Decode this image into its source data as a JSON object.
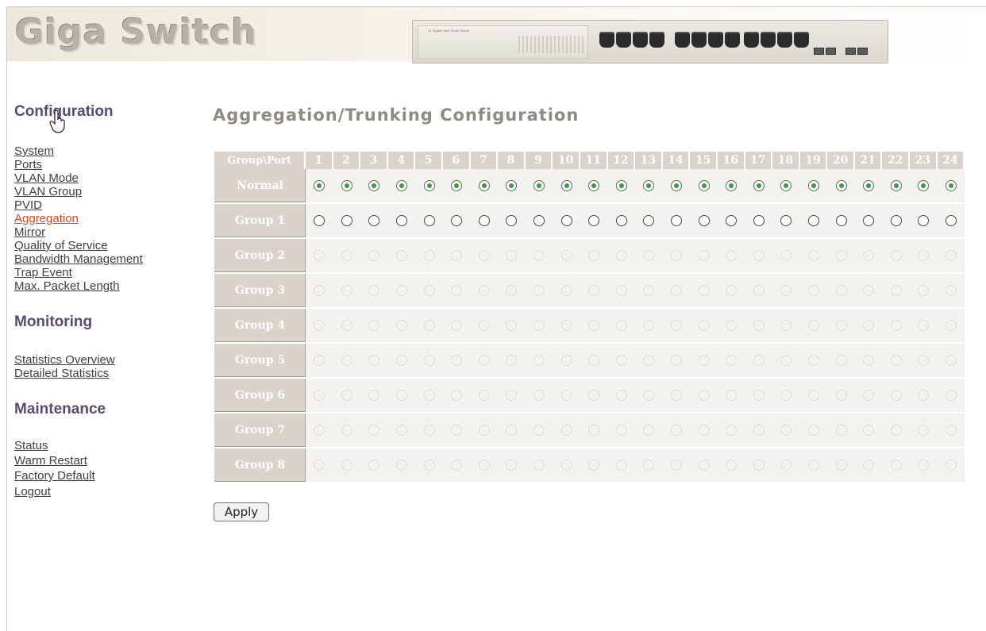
{
  "header": {
    "brand": "Giga Switch",
    "device_image": {
      "plate_text": "24 Gigabit Web Smart Switch"
    }
  },
  "sidebar": {
    "sections": [
      {
        "title": "Configuration",
        "links": [
          "System",
          "Ports",
          "VLAN Mode",
          "VLAN Group",
          "PVID",
          "Aggregation",
          "Mirror",
          "Quality of Service",
          "Bandwidth Management",
          "Trap Event",
          "Max. Packet Length"
        ]
      },
      {
        "title": "Monitoring",
        "links": [
          "Statistics Overview",
          "Detailed Statistics"
        ]
      },
      {
        "title": "Maintenance",
        "links": [
          "Status",
          "Warm Restart",
          "Factory Default",
          "Logout"
        ]
      }
    ],
    "active_link": "Aggregation"
  },
  "main": {
    "title": "Aggregation/Trunking Configuration",
    "table": {
      "corner_label": "Group\\Port",
      "ports": [
        "1",
        "2",
        "3",
        "4",
        "5",
        "6",
        "7",
        "8",
        "9",
        "10",
        "11",
        "12",
        "13",
        "14",
        "15",
        "16",
        "17",
        "18",
        "19",
        "20",
        "21",
        "22",
        "23",
        "24"
      ],
      "rows": [
        {
          "label": "Normal",
          "state": "selected"
        },
        {
          "label": "Group 1",
          "state": "unselected"
        },
        {
          "label": "Group 2",
          "state": "dimmed"
        },
        {
          "label": "Group 3",
          "state": "dimmed"
        },
        {
          "label": "Group 4",
          "state": "dimmed"
        },
        {
          "label": "Group 5",
          "state": "dimmed"
        },
        {
          "label": "Group 6",
          "state": "dimmed"
        },
        {
          "label": "Group 7",
          "state": "dimmed"
        },
        {
          "label": "Group 8",
          "state": "dimmed"
        }
      ]
    },
    "apply_label": "Apply"
  },
  "colors": {
    "section_heading": "#5a4a72",
    "active_link": "#e8431b",
    "table_header_bg": "#d9d3cb",
    "radio_selected": "#3e9a3c"
  }
}
